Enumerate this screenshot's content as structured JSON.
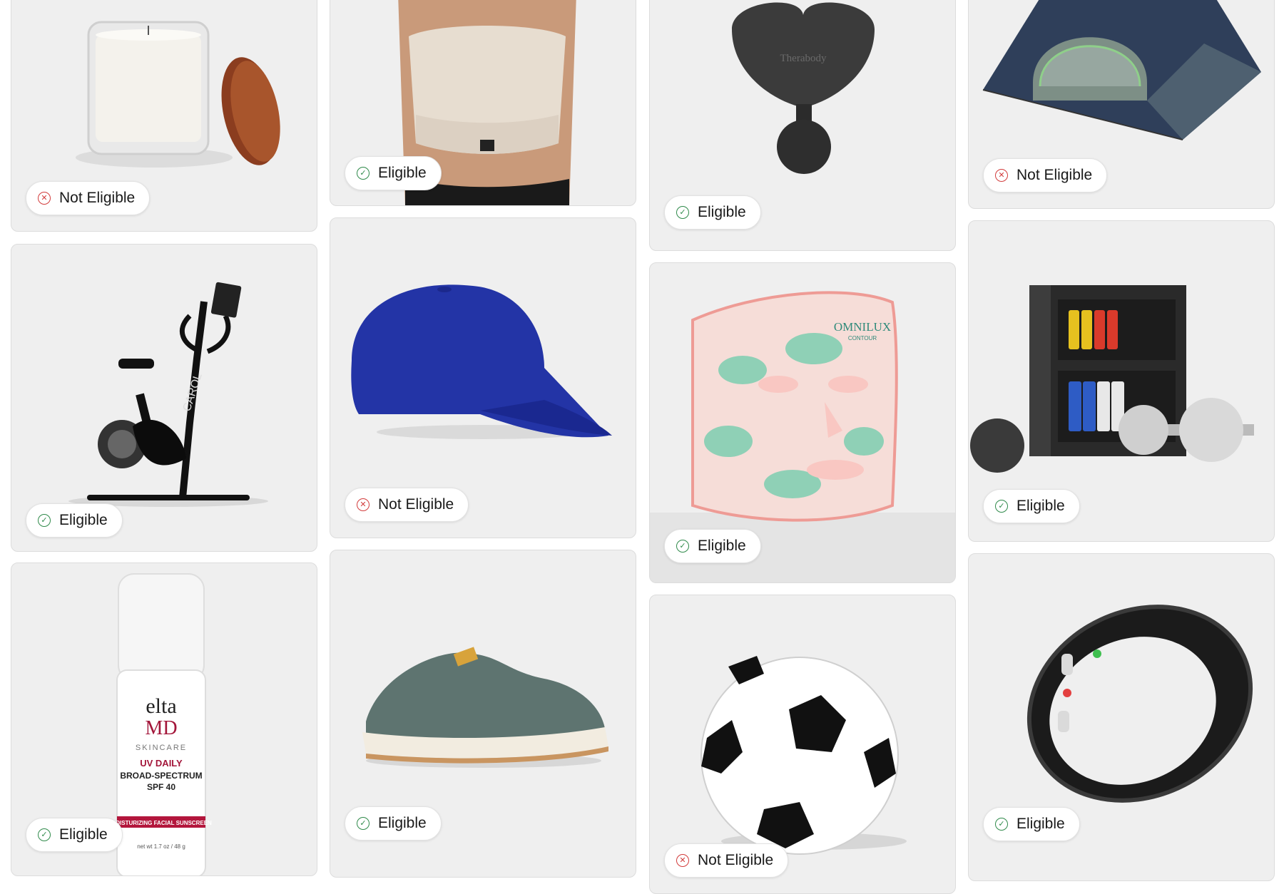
{
  "products": [
    {
      "name": "Candle",
      "status": "Not Eligible",
      "status_icon": "x-circle-icon"
    },
    {
      "name": "Sports bra",
      "status": "Eligible",
      "status_icon": "check-circle-icon"
    },
    {
      "name": "Massage gun",
      "status": "Eligible",
      "status_icon": "check-circle-icon",
      "brand_text": "Therabody"
    },
    {
      "name": "Tent",
      "status": "Not Eligible",
      "status_icon": "x-circle-icon"
    },
    {
      "name": "Exercise bike",
      "status": "Eligible",
      "status_icon": "check-circle-icon",
      "brand_text": "CAROL"
    },
    {
      "name": "Baseball cap",
      "status": "Not Eligible",
      "status_icon": "x-circle-icon"
    },
    {
      "name": "LED face mask",
      "status": "Eligible",
      "status_icon": "check-circle-icon",
      "brand_text": "OMNILUX",
      "sub_text": "CONTOUR"
    },
    {
      "name": "Home gym cabinet",
      "status": "Eligible",
      "status_icon": "check-circle-icon"
    },
    {
      "name": "Sunscreen",
      "status": "Eligible",
      "status_icon": "check-circle-icon",
      "label_lines": [
        "elta",
        "MD",
        "SKINCARE",
        "UV DAILY",
        "BROAD-SPECTRUM",
        "SPF 40",
        "MOISTURIZING FACIAL SUNSCREEN",
        "net wt 1.7 oz / 48 g"
      ]
    },
    {
      "name": "Sneaker",
      "status": "Eligible",
      "status_icon": "check-circle-icon"
    },
    {
      "name": "Soccer ball",
      "status": "Not Eligible",
      "status_icon": "x-circle-icon"
    },
    {
      "name": "Smart ring",
      "status": "Eligible",
      "status_icon": "check-circle-icon"
    }
  ],
  "colors": {
    "card_bg": "#efefef",
    "eligible": "#2f8a4a",
    "not_eligible": "#d23b3b"
  }
}
